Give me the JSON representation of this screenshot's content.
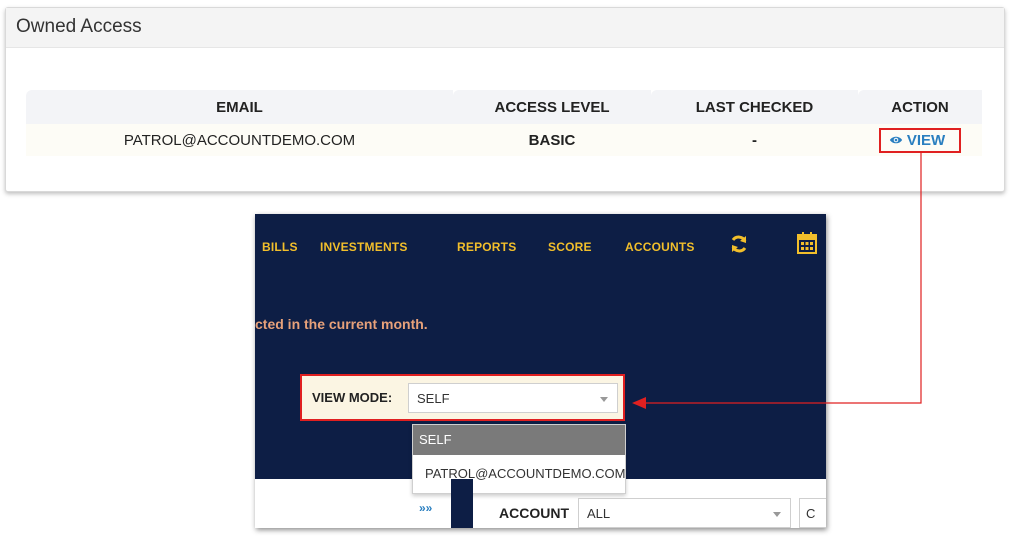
{
  "panel": {
    "title": "Owned Access",
    "columns": [
      "EMAIL",
      "ACCESS LEVEL",
      "LAST CHECKED",
      "ACTION"
    ],
    "rows": [
      {
        "email": "PATROL@ACCOUNTDEMO.COM",
        "access_level": "BASIC",
        "last_checked": "-",
        "action": "VIEW"
      }
    ]
  },
  "nav": {
    "items": [
      "BILLS",
      "INVESTMENTS",
      "REPORTS",
      "SCORE",
      "ACCOUNTS"
    ],
    "refresh_icon": "refresh-icon",
    "calendar_icon": "calendar-icon"
  },
  "notice": "cted in the current month.",
  "view_mode": {
    "label": "VIEW MODE:",
    "selected": "SELF",
    "options": [
      "SELF",
      "PATROL@ACCOUNTDEMO.COM"
    ]
  },
  "toolbar": {
    "chevrons": "»»",
    "account_label": "ACCOUNT",
    "account_value": "ALL",
    "cut_button": "C"
  },
  "colors": {
    "nav_bg": "#0d1e45",
    "nav_text": "#f2bf2b",
    "highlight": "#e02020",
    "link": "#2a7fc0"
  }
}
